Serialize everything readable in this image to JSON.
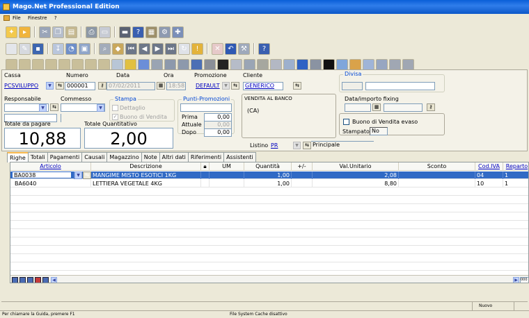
{
  "window": {
    "title": "Mago.Net Professional Edition"
  },
  "menu": [
    "File",
    "Finestre",
    "?"
  ],
  "header": {
    "cassa_label": "Cassa",
    "cassa_value": "PCSVILUPPO",
    "numero_label": "Numero",
    "numero_value": "000001",
    "data_label": "Data",
    "data_value": "07/02/2011",
    "ora_label": "Ora",
    "ora_value": "18:58",
    "promozione_label": "Promozione",
    "promozione_value": "DEFAULT",
    "cliente_label": "Cliente",
    "cliente_value": "GENERICO",
    "cliente_name": "VENDITA AL BANCO",
    "cliente_prov": "(CA)",
    "divisa_label": "Divisa",
    "responsabile_label": "Responsabile",
    "commesso_label": "Commesso",
    "stampa_label": "Stampa",
    "dettaglio_label": "Dettaglio",
    "buono_label": "Buono di Vendita",
    "punti_label": "Punti-Promozioni",
    "prima_label": "Prima",
    "prima_value": "0,00",
    "attuale_label": "Attuale",
    "attuale_value": "0,00",
    "dopo_label": "Dopo",
    "dopo_value": "0,00",
    "fixing_label": "Data/importo fixing",
    "evaso_label": "Buono di Vendita evaso",
    "stampato_label": "Stampato",
    "stampato_value": "No",
    "totale_pagare_label": "Totale da pagare",
    "totale_pagare_value": "10,88",
    "totale_quant_label": "Totale Quantitativo",
    "totale_quant_value": "2,00",
    "listino_label": "Listino",
    "listino_value": "PR",
    "listino_desc": "Principale"
  },
  "tabs": [
    "Righe",
    "Totali",
    "Pagamenti",
    "Causali",
    "Magazzino",
    "Note",
    "Altri dati",
    "Riferimenti",
    "Assistenti"
  ],
  "grid": {
    "columns": [
      "Articolo",
      "Descrizione",
      "",
      "UM",
      "Quantità",
      "+/-",
      "Val.Unitario",
      "Sconto",
      "Cod.IVA",
      "Reparto"
    ],
    "rows": [
      [
        "BA0038",
        "MANGIME MISTO ESOTICI 1KG",
        "",
        "",
        "1,00",
        "",
        "2,08",
        "",
        "04",
        "1"
      ],
      [
        "BA6040",
        "LETTIERA VEGETALE 4KG",
        "",
        "",
        "1,00",
        "",
        "8,80",
        "",
        "10",
        "1"
      ]
    ],
    "hscroll_value": "000"
  },
  "statusbar": {
    "state": "Nuovo",
    "help": "Per chiamare la Guida, premere F1",
    "cache": "File System Cache disattivo"
  },
  "colors": {
    "title": "#0a5fd8",
    "selection": "#316ac5",
    "link": "#0000c0"
  }
}
